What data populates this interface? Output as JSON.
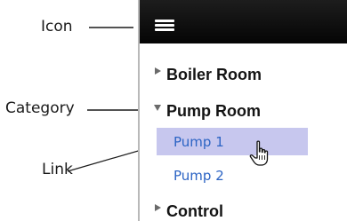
{
  "callouts": {
    "icon": "Icon",
    "category": "Category",
    "link": "Link"
  },
  "menu": {
    "icon_name": "hamburger-menu-icon",
    "categories": [
      {
        "label": "Boiler Room",
        "expanded": false
      },
      {
        "label": "Pump Room",
        "expanded": true,
        "links": [
          {
            "label": "Pump 1",
            "selected": true
          },
          {
            "label": "Pump 2",
            "selected": false
          }
        ]
      },
      {
        "label": "Control",
        "expanded": false
      }
    ]
  },
  "colors": {
    "top_bar": "#0c0c0c",
    "selected_link_bg": "#c7c7ee",
    "link_text": "#2c64c4",
    "category_text": "#141414",
    "arrow": "#6a6a6a"
  },
  "pointer": "hand-cursor-icon"
}
